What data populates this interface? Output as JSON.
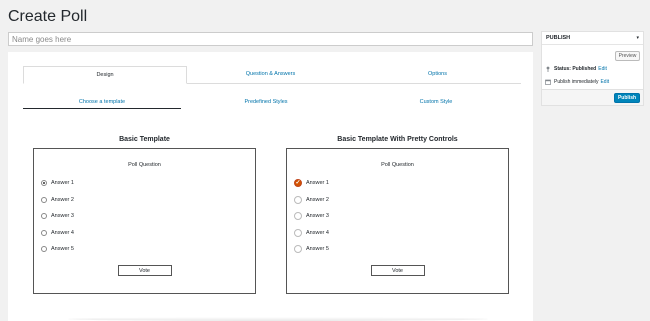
{
  "page": {
    "title": "Create Poll"
  },
  "name_input": {
    "placeholder": "Name goes here",
    "value": ""
  },
  "tabs": [
    {
      "label": "Design",
      "active": true
    },
    {
      "label": "Question & Answers",
      "active": false
    },
    {
      "label": "Options",
      "active": false
    }
  ],
  "subtabs": [
    {
      "label": "Choose a template",
      "active": true
    },
    {
      "label": "Predefined Styles",
      "active": false
    },
    {
      "label": "Custom Style",
      "active": false
    }
  ],
  "templates": [
    {
      "title": "Basic Template",
      "question": "Poll Question",
      "answers": [
        "Answer 1",
        "Answer 2",
        "Answer 3",
        "Answer 4",
        "Answer 5"
      ],
      "selected_answer": "Answer 1",
      "vote_label": "Vote"
    },
    {
      "title": "Basic Template With Pretty Controls",
      "question": "Poll Question",
      "answers": [
        "Answer 1",
        "Answer 2",
        "Answer 3",
        "Answer 4",
        "Answer 5"
      ],
      "selected_answer": "Answer 1",
      "vote_label": "Vote"
    }
  ],
  "publish": {
    "title": "PUBLISH",
    "toggle_icon": "caret-down-icon",
    "preview_label": "Preview",
    "status_label": "Status: Published",
    "status_edit": "Edit",
    "schedule_label": "Publish immediately",
    "schedule_edit": "Edit",
    "publish_label": "Publish",
    "accent_color": "#0085ba",
    "pretty_control_color": "#d35400"
  }
}
